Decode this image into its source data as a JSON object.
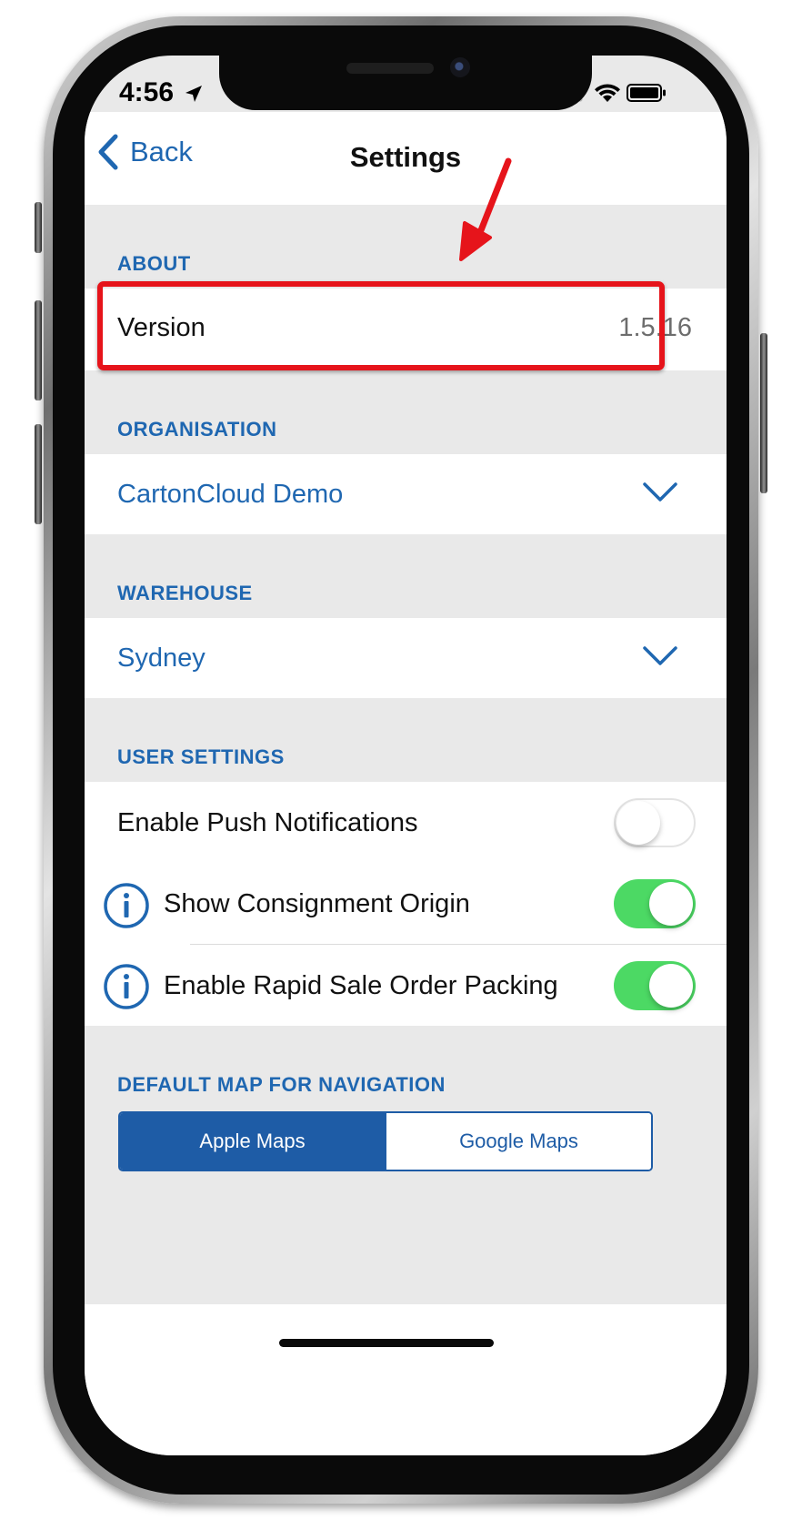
{
  "status_bar": {
    "time": "4:56",
    "icons": [
      "location-arrow-icon",
      "cellular-signal-icon",
      "wifi-icon",
      "battery-icon"
    ]
  },
  "nav": {
    "back_label": "Back",
    "title": "Settings"
  },
  "about": {
    "header": "ABOUT",
    "version_label": "Version",
    "version_value": "1.5.16"
  },
  "organisation": {
    "header": "ORGANISATION",
    "selected": "CartonCloud Demo"
  },
  "warehouse": {
    "header": "WAREHOUSE",
    "selected": "Sydney"
  },
  "user_settings": {
    "header": "USER SETTINGS",
    "items": [
      {
        "label": "Enable Push Notifications",
        "enabled": false,
        "has_info": false
      },
      {
        "label": "Show Consignment Origin",
        "enabled": true,
        "has_info": true
      },
      {
        "label": "Enable Rapid Sale Order Packing",
        "enabled": true,
        "has_info": true
      }
    ]
  },
  "default_map": {
    "header": "DEFAULT MAP FOR NAVIGATION",
    "options": [
      "Apple Maps",
      "Google Maps"
    ],
    "selected": "Apple Maps"
  },
  "colors": {
    "accent_blue": "#1f67b1",
    "segment_blue": "#1e5ca6",
    "toggle_green": "#4cd964",
    "annotation_red": "#e6141b",
    "group_background": "#e9e9e9"
  }
}
